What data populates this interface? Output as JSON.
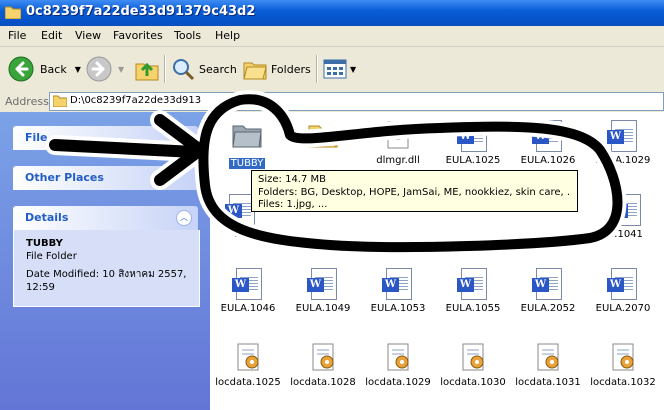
{
  "window": {
    "title": "0c8239f7a22de33d91379c43d2"
  },
  "menu": [
    "File",
    "Edit",
    "View",
    "Favorites",
    "Tools",
    "Help"
  ],
  "toolbar": {
    "back": "Back",
    "search": "Search",
    "folders": "Folders"
  },
  "address": {
    "label": "Address",
    "path": "D:\\0c8239f7a22de33d913"
  },
  "sidebar": {
    "file_tasks": "File",
    "other_places": "Other Places",
    "details": {
      "title": "Details",
      "name": "TUBBY",
      "type": "File Folder",
      "modified": "Date Modified: 10 สิงหาคม 2557, 12:59"
    }
  },
  "files": {
    "row1": [
      "TUBBY",
      "",
      "dlmgr.dll",
      "EULA.1025",
      "EULA.1026",
      "EULA.1029"
    ],
    "row2_partial": [
      "EU",
      "",
      "",
      "",
      "",
      "..1041"
    ],
    "row3": [
      "EULA.1046",
      "EULA.1049",
      "EULA.1053",
      "EULA.1055",
      "EULA.2052",
      "EULA.2070"
    ],
    "row4": [
      "locdata.1025",
      "locdata.1028",
      "locdata.1029",
      "locdata.1030",
      "locdata.1031",
      "locdata.1032"
    ]
  },
  "tooltip": {
    "size": "Size: 14.7 MB",
    "folders": "Folders: BG, Desktop, HOPE, JamSai, ME, nookkiez, skin care, ...",
    "files": "Files: 1.jpg, ..."
  },
  "colors": {
    "titlebar": "#0a5fd8",
    "sidebar": "#6f8ee0",
    "selection": "#316ac5",
    "tooltip_bg": "#ffffe1"
  }
}
